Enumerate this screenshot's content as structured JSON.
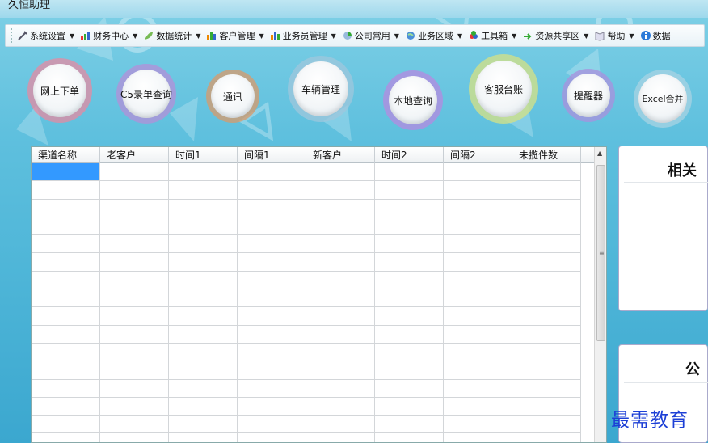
{
  "window": {
    "title": "久恒助理"
  },
  "menubar": {
    "items": [
      {
        "label": "系统设置",
        "icon": "tools-icon"
      },
      {
        "label": "财务中心",
        "icon": "bar-chart-icon"
      },
      {
        "label": "数据统计",
        "icon": "leaf-chart-icon"
      },
      {
        "label": "客户管理",
        "icon": "bars-icon"
      },
      {
        "label": "业务员管理",
        "icon": "bars-icon"
      },
      {
        "label": "公司常用",
        "icon": "pie-icon"
      },
      {
        "label": "业务区域",
        "icon": "globe-icon"
      },
      {
        "label": "工具箱",
        "icon": "toolbox-icon"
      },
      {
        "label": "资源共享区",
        "icon": "share-icon"
      },
      {
        "label": "帮助",
        "icon": "book-icon"
      },
      {
        "label": "数据",
        "icon": "info-icon"
      }
    ]
  },
  "tiles": [
    {
      "label": "网上下单",
      "ring": "#e68aa2"
    },
    {
      "label": "C5录单查询",
      "ring": "#b48fd8"
    },
    {
      "label": "通讯",
      "ring": "#d99a6a"
    },
    {
      "label": "车辆管理",
      "ring": "#9fc7dc"
    },
    {
      "label": "本地查询",
      "ring": "#b58ae0"
    },
    {
      "label": "客服台账",
      "ring": "#cfe08a"
    },
    {
      "label": "提醒器",
      "ring": "#a990de"
    },
    {
      "label": "Excel合并",
      "ring": "#a8d3e3"
    }
  ],
  "grid": {
    "columns": [
      "渠道名称",
      "老客户",
      "时间1",
      "间隔1",
      "新客户",
      "时间2",
      "间隔2",
      "未揽件数"
    ],
    "row_count": 16,
    "selected": {
      "row": 0,
      "col": 0
    }
  },
  "panels": {
    "related": {
      "title": "相关"
    },
    "notice": {
      "title": "公"
    }
  },
  "watermark": "最需教育"
}
